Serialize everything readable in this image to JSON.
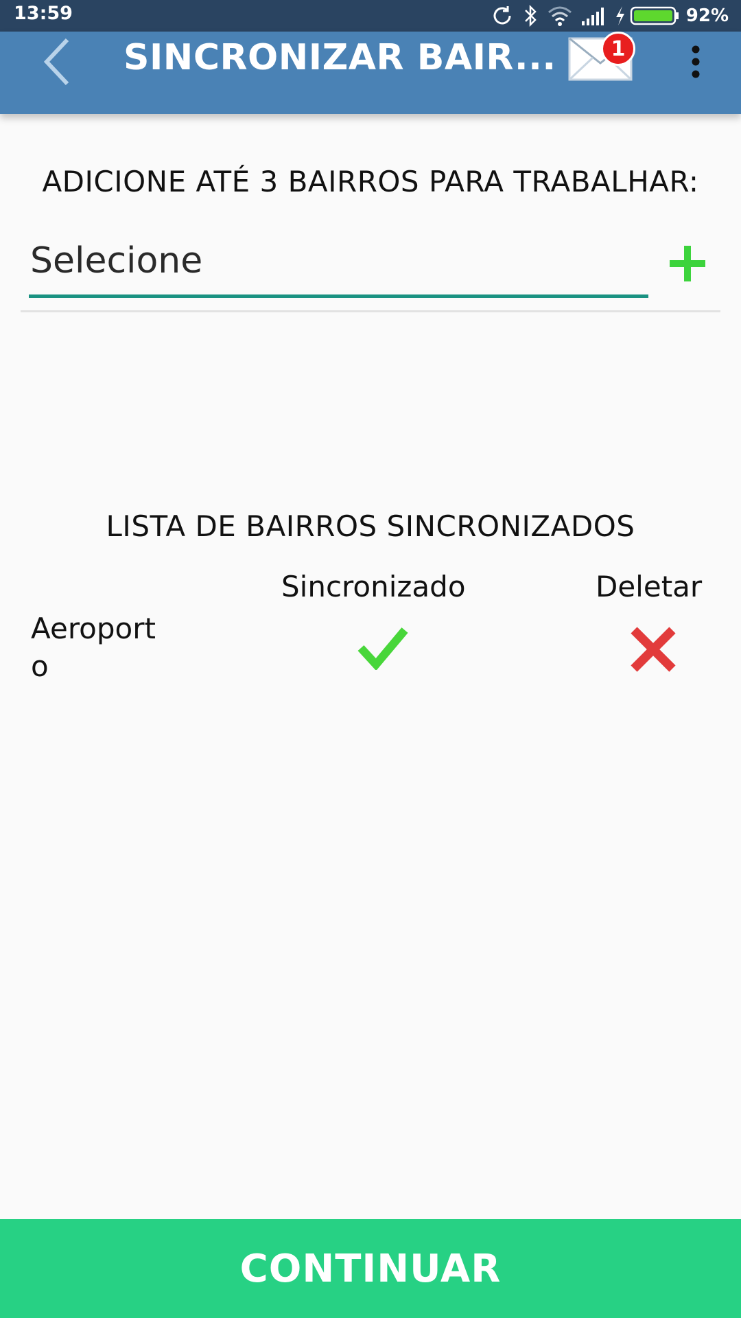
{
  "status_bar": {
    "time": "13:59",
    "battery_percent": "92%",
    "icons": [
      "sync-icon",
      "bluetooth-icon",
      "wifi-icon",
      "signal-icon",
      "charging-icon",
      "battery-icon"
    ]
  },
  "app_bar": {
    "title": "SINCRONIZAR BAIR...",
    "mail_badge_count": "1",
    "color": "#4a82b5"
  },
  "add_section": {
    "heading": "ADICIONE ATÉ 3 BAIRROS PARA TRABALHAR:",
    "select_value": "Selecione",
    "add_icon": "plus-icon",
    "accent_color": "#1a9282"
  },
  "list_section": {
    "heading": "LISTA DE BAIRROS SINCRONIZADOS",
    "columns": {
      "synced": "Sincronizado",
      "delete": "Deletar"
    },
    "rows": [
      {
        "name": "Aeroporto",
        "synced_icon": "check-icon",
        "delete_icon": "close-icon"
      }
    ]
  },
  "footer": {
    "continue_label": "CONTINUAR",
    "color": "#27d184"
  }
}
